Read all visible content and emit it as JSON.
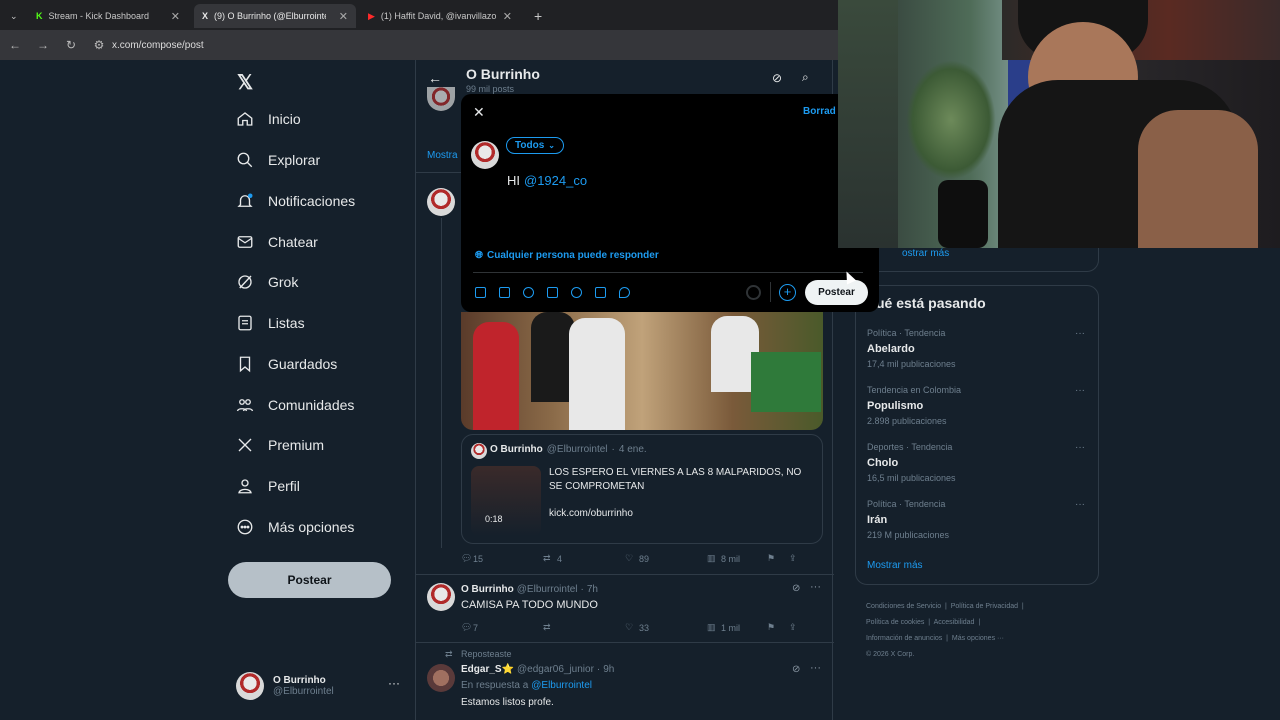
{
  "browser": {
    "tabs": [
      {
        "title": "Stream - Kick Dashboard",
        "active": false
      },
      {
        "title": "(9) O Burrinho (@Elburrointel) /",
        "active": true
      },
      {
        "title": "(1) Haffit David, @ivanvillazonc",
        "active": false
      }
    ],
    "url": "x.com/compose/post"
  },
  "sidebar": {
    "items": [
      {
        "label": "Inicio",
        "icon": "home-icon"
      },
      {
        "label": "Explorar",
        "icon": "search-icon"
      },
      {
        "label": "Notificaciones",
        "icon": "bell-icon"
      },
      {
        "label": "Chatear",
        "icon": "mail-icon"
      },
      {
        "label": "Grok",
        "icon": "grok-icon"
      },
      {
        "label": "Listas",
        "icon": "list-icon"
      },
      {
        "label": "Guardados",
        "icon": "bookmark-icon"
      },
      {
        "label": "Comunidades",
        "icon": "people-icon"
      },
      {
        "label": "Premium",
        "icon": "x-icon"
      },
      {
        "label": "Perfil",
        "icon": "person-icon"
      },
      {
        "label": "Más opciones",
        "icon": "more-circle-icon"
      }
    ],
    "post_button": "Postear",
    "account": {
      "name": "O Burrinho",
      "handle": "@Elburrointel"
    }
  },
  "profile_header": {
    "name": "O Burrinho",
    "posts_count": "99 mil posts"
  },
  "timeline": {
    "show_more": "Mostra",
    "quoted_post": {
      "name": "O Burrinho",
      "handle": "@Elburrointel",
      "date": "4 ene.",
      "text": "LOS ESPERO EL VIERNES A LAS 8 MALPARIDOS, NO SE COMPROMETAN",
      "link": "kick.com/oburrinho",
      "video_duration": "0:18"
    },
    "post1_stats": {
      "replies": "15",
      "reposts": "4",
      "likes": "89",
      "views": "8 mil"
    },
    "post2": {
      "name": "O Burrinho",
      "handle": "@Elburrointel",
      "time": "7h",
      "text": "CAMISA PA TODO MUNDO",
      "stats": {
        "replies": "7",
        "reposts": "",
        "likes": "33",
        "views": "1 mil"
      }
    },
    "post3": {
      "repost_label": "Reposteaste",
      "name": "Edgar_S⭐",
      "handle": "@edgar06_junior",
      "time": "9h",
      "reply_to_prefix": "En respuesta a",
      "reply_to": "@Elburrointel",
      "text": "Estamos listos profe."
    }
  },
  "compose": {
    "drafts": "Borrad",
    "audience": "Todos",
    "text_plain": "HI",
    "text_mention": "@1924_co",
    "reply_setting": "Cualquier persona puede responder",
    "submit": "Postear"
  },
  "right": {
    "show_more_top": "ostrar más",
    "heading": "ué está pasando",
    "trends": [
      {
        "context": "Política · Tendencia",
        "name": "Abelardo",
        "count": "17,4 mil publicaciones"
      },
      {
        "context": "Tendencia en Colombia",
        "name": "Populismo",
        "count": "2.898 publicaciones"
      },
      {
        "context": "Deportes · Tendencia",
        "name": "Cholo",
        "count": "16,5 mil publicaciones"
      },
      {
        "context": "Política · Tendencia",
        "name": "Irán",
        "count": "219 M publicaciones"
      }
    ],
    "show_more": "Mostrar más",
    "footer": {
      "l1a": "Condiciones de Servicio",
      "l1b": "Política de Privacidad",
      "l2a": "Política de cookies",
      "l2b": "Accesibilidad",
      "l3a": "Información de anuncios",
      "l3b": "Más opciones ···",
      "copyright": "© 2026 X Corp."
    }
  },
  "colors": {
    "accent": "#1d9bf0",
    "background": "#15202b",
    "modal": "#000000"
  }
}
